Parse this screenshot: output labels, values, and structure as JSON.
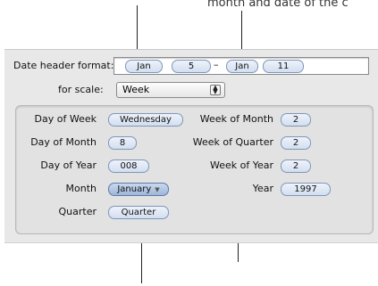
{
  "caption": {
    "top": "month and date of the c"
  },
  "format": {
    "label": "Date header format:",
    "tokens": [
      "Jan",
      "5",
      "Jan",
      "11"
    ],
    "separator": "–"
  },
  "scale": {
    "label": "for scale:",
    "value": "Week"
  },
  "fields": {
    "day_of_week": {
      "label": "Day of Week",
      "value": "Wednesday"
    },
    "day_of_month": {
      "label": "Day of Month",
      "value": "8"
    },
    "day_of_year": {
      "label": "Day of Year",
      "value": "008"
    },
    "month": {
      "label": "Month",
      "value": "January"
    },
    "quarter": {
      "label": "Quarter",
      "value": "Quarter"
    },
    "week_of_month": {
      "label": "Week of Month",
      "value": "2"
    },
    "week_of_quarter": {
      "label": "Week of Quarter",
      "value": "2"
    },
    "week_of_year": {
      "label": "Week of Year",
      "value": "2"
    },
    "year": {
      "label": "Year",
      "value": "1997"
    }
  },
  "icons": {
    "stepper": "popup-stepper-icon",
    "chevron": "chevron-down-icon"
  }
}
